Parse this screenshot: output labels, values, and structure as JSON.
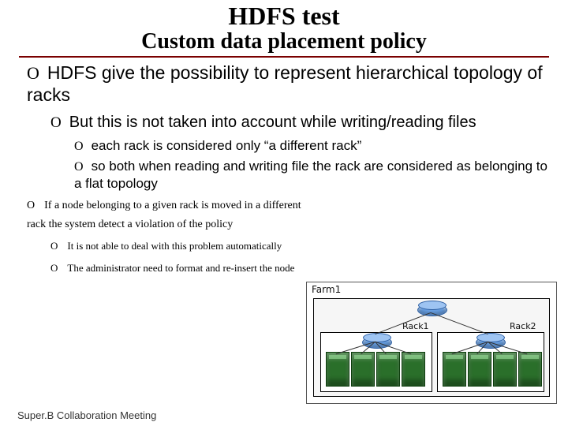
{
  "title": "HDFS test",
  "subtitle": "Custom data placement policy",
  "bullets": {
    "l0": "HDFS give the possibility to represent hierarchical topology of racks",
    "l1_0": "But this is not taken into account while writing/reading files",
    "l2_0": "each rack is considered only “a different rack”",
    "l2_1": "so both when reading and writing file the rack are considered as belonging to a flat topology",
    "s0": "If a node belonging to a given rack is moved in a different rack the system detect a violation of the policy",
    "s1_0": "It is not able to deal with this problem automatically",
    "s1_1": "The administrator need to format and re-insert the node"
  },
  "marker": "O",
  "diagram": {
    "farm": "Farm1",
    "rack1": "Rack1",
    "rack2": "Rack2"
  },
  "footer": "Super.B Collaboration Meeting"
}
